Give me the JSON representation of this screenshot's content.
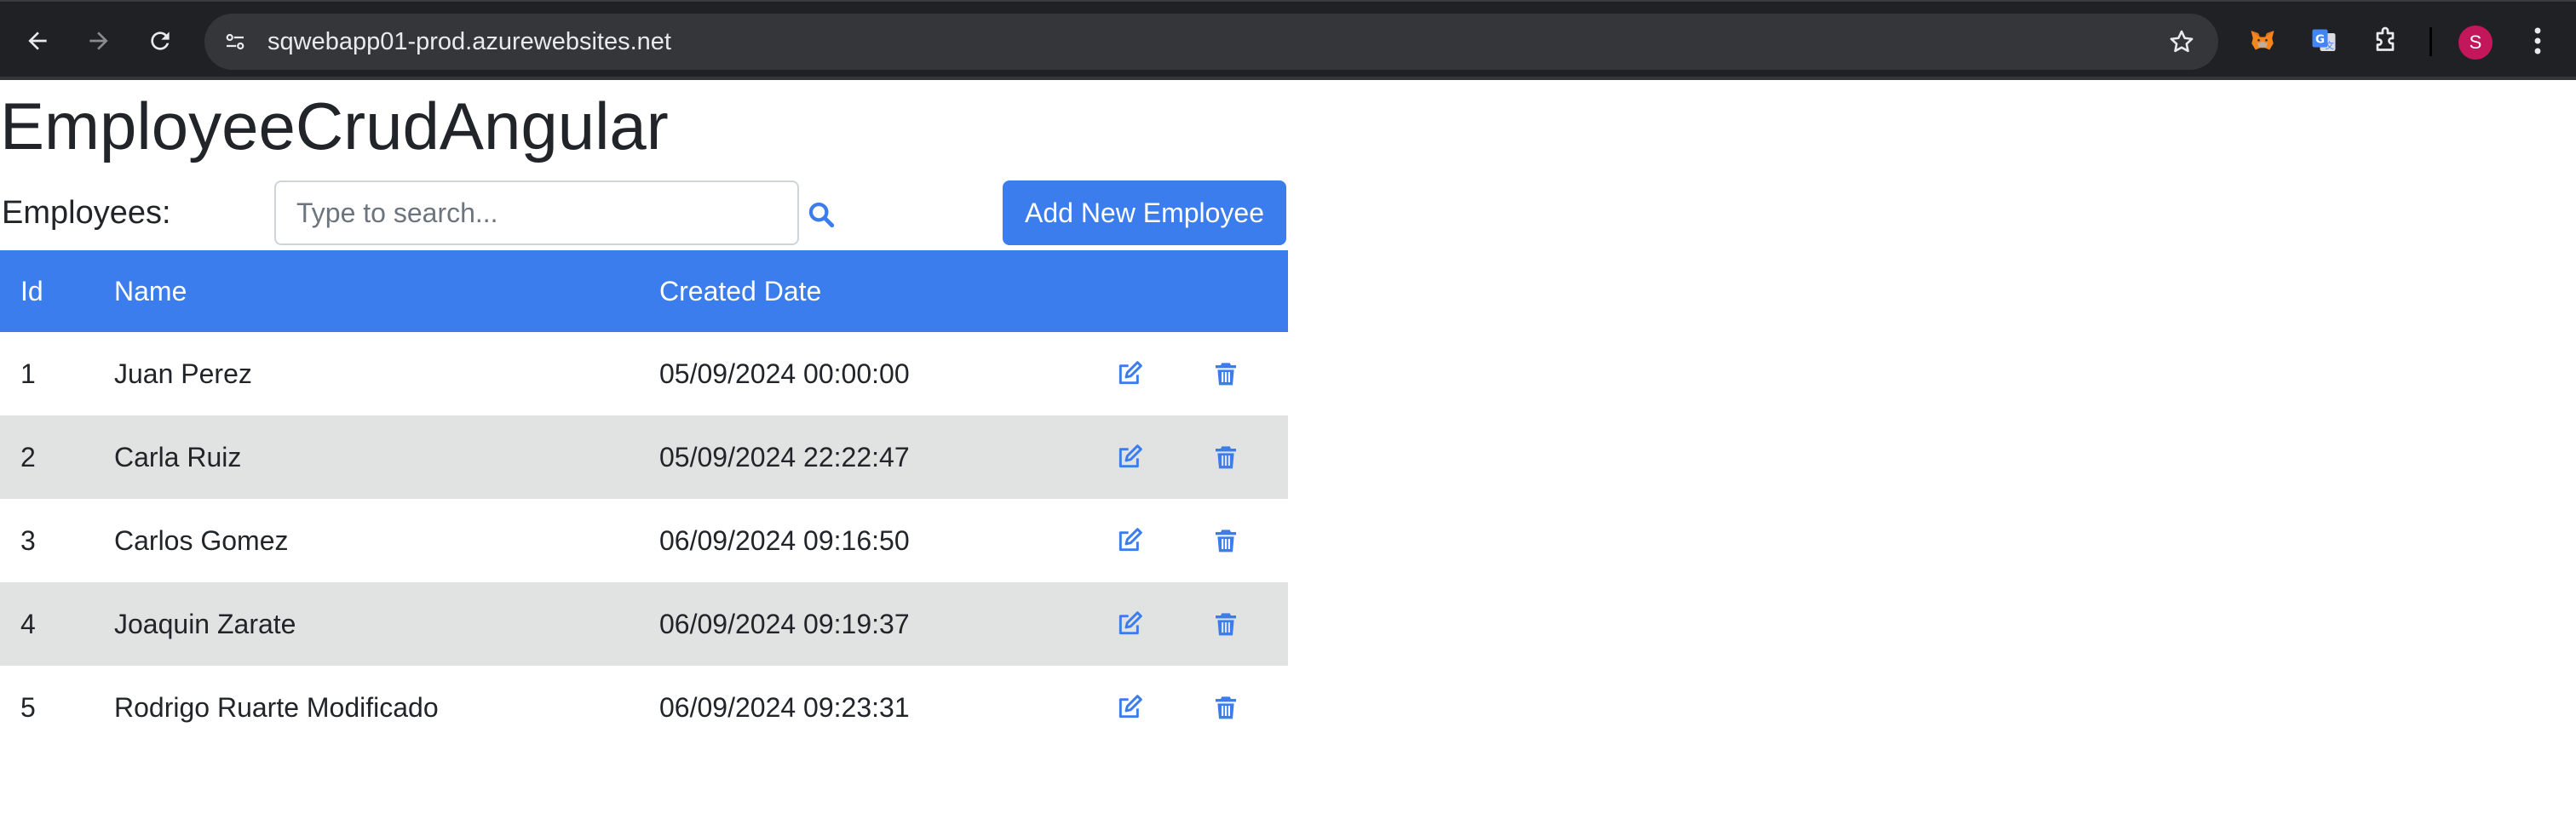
{
  "browser": {
    "url": "sqwebapp01-prod.azurewebsites.net",
    "avatar_letter": "S",
    "icons": [
      "back-icon",
      "forward-icon",
      "reload-icon",
      "site-info-icon",
      "bookmark-star-icon",
      "metamask-icon",
      "google-translate-icon",
      "extensions-puzzle-icon",
      "kebab-menu-icon"
    ],
    "colors": {
      "chrome_bg": "#202124",
      "omnibox_bg": "#35363a",
      "avatar_bg": "#c2185b"
    }
  },
  "app": {
    "title": "EmployeeCrudAngular",
    "employees_label": "Employees:",
    "search": {
      "placeholder": "Type to search...",
      "value": ""
    },
    "add_button_label": "Add New Employee",
    "accent_color": "#3b7ded",
    "stripe_color": "#e1e3e2"
  },
  "table": {
    "columns": [
      "Id",
      "Name",
      "Created Date",
      "",
      ""
    ],
    "rows": [
      {
        "id": "1",
        "name": "Juan Perez",
        "created": "05/09/2024 00:00:00"
      },
      {
        "id": "2",
        "name": "Carla Ruiz",
        "created": "05/09/2024 22:22:47"
      },
      {
        "id": "3",
        "name": "Carlos Gomez",
        "created": "06/09/2024 09:16:50"
      },
      {
        "id": "4",
        "name": "Joaquin Zarate",
        "created": "06/09/2024 09:19:37"
      },
      {
        "id": "5",
        "name": "Rodrigo Ruarte Modificado",
        "created": "06/09/2024 09:23:31"
      }
    ],
    "row_action_icons": [
      "edit-icon",
      "trash-icon"
    ]
  }
}
